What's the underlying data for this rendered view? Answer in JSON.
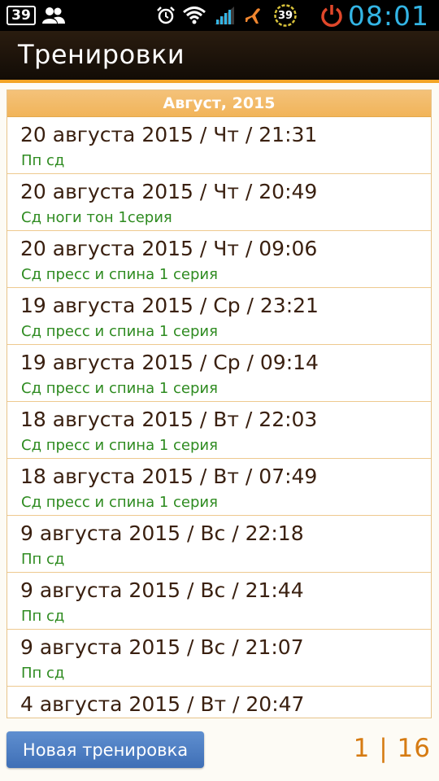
{
  "status_bar": {
    "notification_count": "39",
    "battery_level": "39",
    "time": "08:01",
    "icons": [
      "notification-count-icon",
      "users-icon",
      "alarm-icon",
      "wifi-icon",
      "signal-icon",
      "airplane-icon",
      "battery-icon",
      "power-icon"
    ],
    "accent": "#33b5e5"
  },
  "action_bar": {
    "title": "Тренировки",
    "accent": "#f3a425"
  },
  "list": {
    "section_header": "Август, 2015",
    "rows": [
      {
        "date": "20 августа 2015 / Чт / 21:31",
        "name": "Пп сд"
      },
      {
        "date": "20 августа 2015 / Чт / 20:49",
        "name": "Сд ноги тон 1серия"
      },
      {
        "date": "20 августа 2015 / Чт / 09:06",
        "name": "Сд пресс и спина 1 серия"
      },
      {
        "date": "19 августа 2015 / Ср / 23:21",
        "name": "Сд пресс и спина 1 серия"
      },
      {
        "date": "19 августа 2015 / Ср / 09:14",
        "name": "Сд пресс и спина 1 серия"
      },
      {
        "date": "18 августа 2015 / Вт / 22:03",
        "name": "Сд пресс и спина 1 серия"
      },
      {
        "date": "18 августа 2015 / Вт / 07:49",
        "name": "Сд пресс и спина 1 серия"
      },
      {
        "date": "9 августа 2015 / Вс / 22:18",
        "name": "Пп сд"
      },
      {
        "date": "9 августа 2015 / Вс / 21:44",
        "name": "Пп сд"
      },
      {
        "date": "9 августа 2015 / Вс / 21:07",
        "name": "Пп сд"
      },
      {
        "date": "4 августа 2015 / Вт / 20:47",
        "name": ""
      }
    ],
    "date_color": "#3a2010",
    "name_color": "#2e8b20"
  },
  "footer": {
    "new_button_label": "Новая тренировка",
    "pager": "1 | 16"
  }
}
